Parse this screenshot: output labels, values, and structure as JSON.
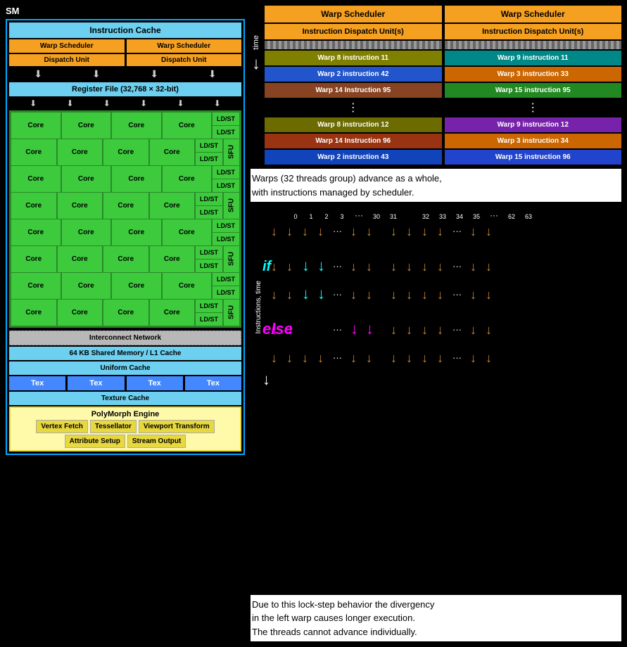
{
  "sm": {
    "label": "SM",
    "instruction_cache": "Instruction Cache",
    "warp_schedulers": [
      "Warp Scheduler",
      "Warp Scheduler"
    ],
    "dispatch_units": [
      "Dispatch Unit",
      "Dispatch Unit"
    ],
    "register_file": "Register File (32,768 × 32-bit)",
    "cores": [
      [
        "Core",
        "Core",
        "Core",
        "Core"
      ],
      [
        "Core",
        "Core",
        "Core",
        "Core"
      ],
      [
        "Core",
        "Core",
        "Core",
        "Core"
      ],
      [
        "Core",
        "Core",
        "Core",
        "Core"
      ],
      [
        "Core",
        "Core",
        "Core",
        "Core"
      ],
      [
        "Core",
        "Core",
        "Core",
        "Core"
      ],
      [
        "Core",
        "Core",
        "Core",
        "Core"
      ],
      [
        "Core",
        "Core",
        "Core",
        "Core"
      ]
    ],
    "ldst_label": "LD/ST",
    "sfu_label": "SFU",
    "interconnect": "Interconnect Network",
    "shared_memory": "64 KB Shared Memory / L1 Cache",
    "uniform_cache": "Uniform Cache",
    "tex_units": [
      "Tex",
      "Tex",
      "Tex",
      "Tex"
    ],
    "texture_cache": "Texture Cache",
    "polymorph": {
      "title": "PolyMorph Engine",
      "buttons_row1": [
        "Vertex Fetch",
        "Tessellator",
        "Viewport Transform"
      ],
      "buttons_row2": [
        "Attribute Setup",
        "Stream Output"
      ]
    }
  },
  "warp_diagram": {
    "left": {
      "warp_scheduler": "Warp Scheduler",
      "idu": "Instruction Dispatch Unit(s)",
      "instructions": [
        {
          "label": "Warp 8 instruction 11",
          "color_class": "wi-olive"
        },
        {
          "label": "Warp 2 instruction 42",
          "color_class": "wi-blue"
        },
        {
          "label": "Warp 14 Instruction 95",
          "color_class": "wi-brown"
        },
        {
          "label": "⋮",
          "dots": true
        },
        {
          "label": "Warp 8 instruction 12",
          "color_class": "wi-olive2"
        },
        {
          "label": "Warp 14 Instruction 96",
          "color_class": "wi-brown2"
        },
        {
          "label": "Warp 2 instruction 43",
          "color_class": "wi-blue2"
        }
      ]
    },
    "right": {
      "warp_scheduler": "Warp Scheduler",
      "idu": "Instruction Dispatch Unit(s)",
      "instructions": [
        {
          "label": "Warp 9 instruction 11",
          "color_class": "wi-teal"
        },
        {
          "label": "Warp 3 instruction 33",
          "color_class": "wi-orange2"
        },
        {
          "label": "Warp 15 instruction 95",
          "color_class": "wi-green"
        },
        {
          "label": "⋮",
          "dots": true
        },
        {
          "label": "Warp 9 instruction 12",
          "color_class": "wi-purple"
        },
        {
          "label": "Warp 3 instruction 34",
          "color_class": "wi-orange2"
        },
        {
          "label": "Warp 15 instruction 96",
          "color_class": "wi-blue3"
        }
      ]
    },
    "time_label": "time"
  },
  "description1": "Warps (32 threads group) advance as a whole,\nwith instructions managed by scheduler.",
  "divergence": {
    "thread_numbers_left": [
      "0",
      "1",
      "2",
      "3"
    ],
    "thread_numbers_dots": "···",
    "thread_numbers_mid": [
      "30",
      "31"
    ],
    "thread_numbers_right_start": [
      "32",
      "33",
      "34",
      "35"
    ],
    "thread_numbers_dots2": "···",
    "thread_numbers_right_end": [
      "62",
      "63"
    ],
    "instructions_time_label": "Instructions, time",
    "if_label": "if",
    "else_label": "else"
  },
  "description2": "Due to this lock-step behavior the divergency\nin the left warp causes longer execution.\nThe threads cannot advance individually."
}
